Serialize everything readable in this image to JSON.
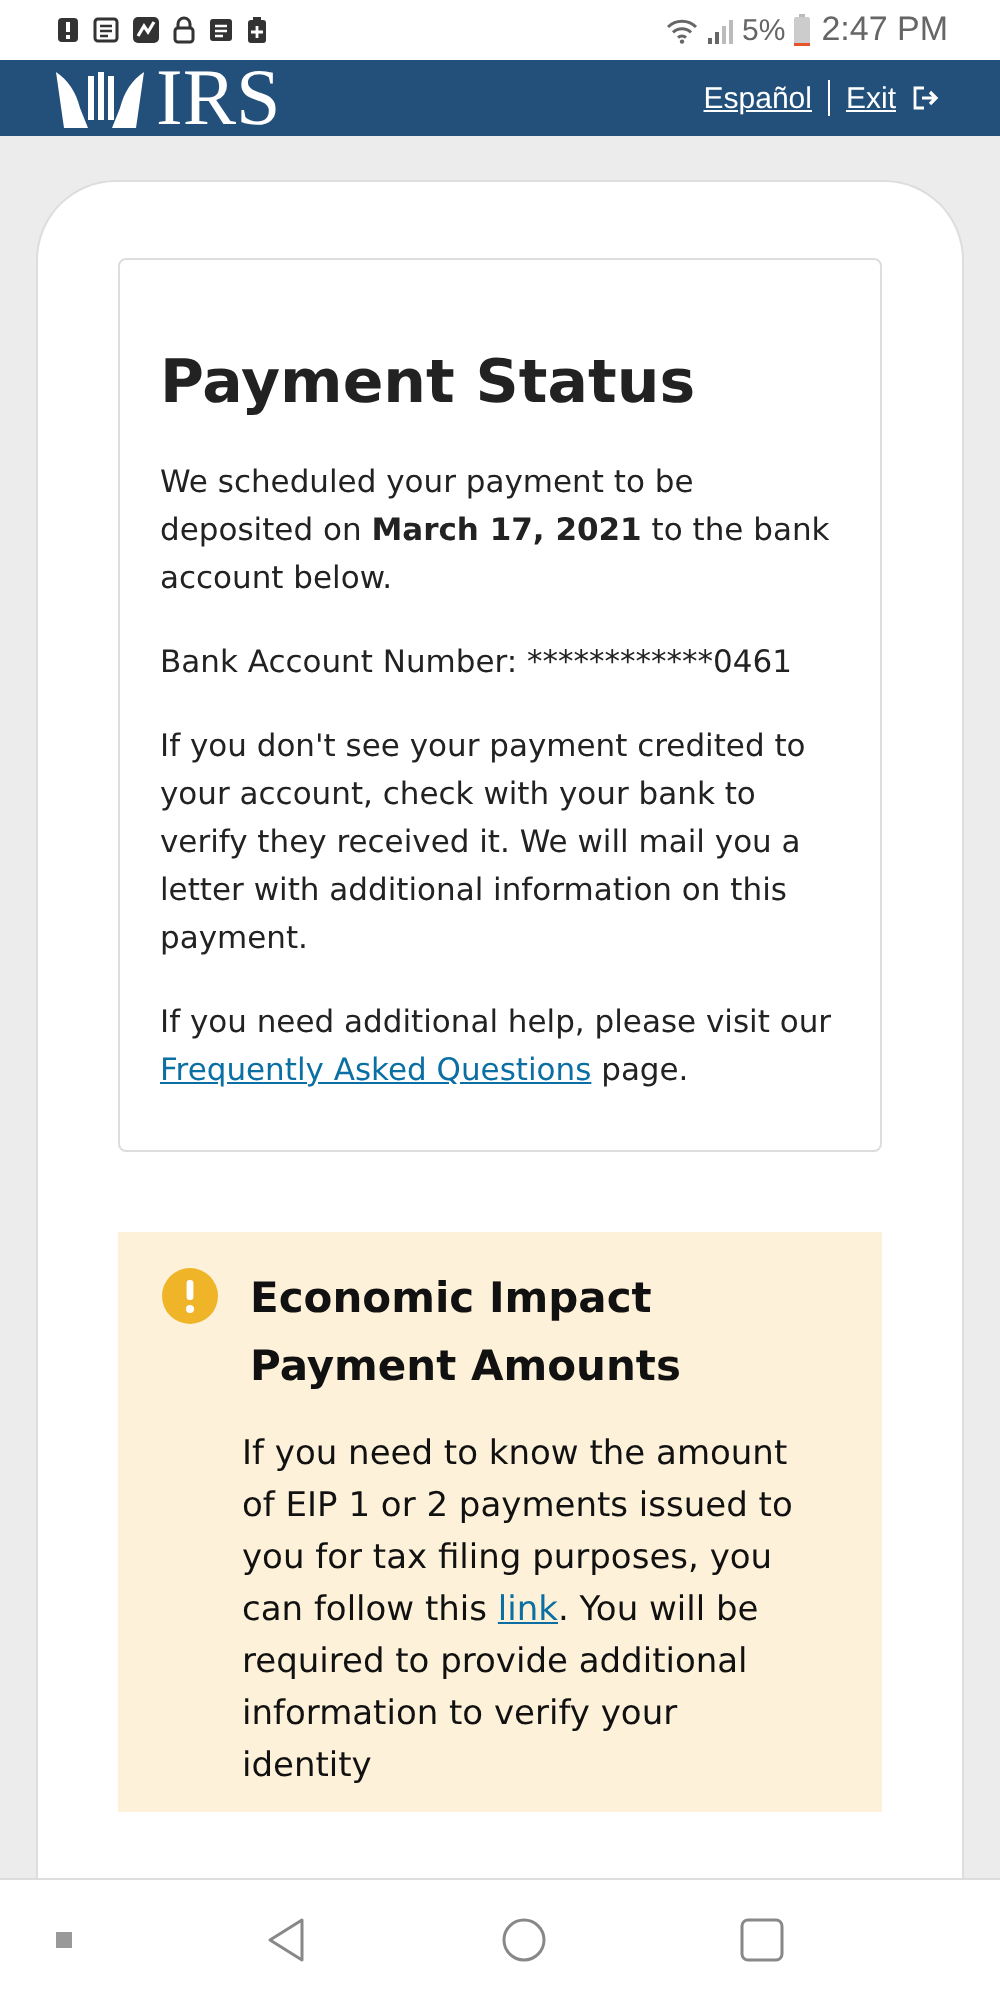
{
  "status_bar": {
    "battery": "5%",
    "time": "2:47 PM"
  },
  "header": {
    "logo": "IRS",
    "links": [
      {
        "label": "Español"
      },
      {
        "label": "Exit"
      }
    ]
  },
  "status_card": {
    "title": "Payment Status",
    "paragraphs": [
      "We scheduled your payment to be deposited on **March 17, 2021** to the bank account below."
    ],
    "account": "Bank Account Number: ************0461",
    "details": [
      "If you don't see your payment credited to your account, check with your bank to verify they received it. We will mail you a letter with additional information on this payment."
    ],
    "help": {
      "before": "If you need additional help, please visit our",
      "link": "Frequently Asked Questions",
      "after": "page."
    }
  },
  "alert": {
    "title": "Economic Impact Payment Amounts",
    "before": "If you need to know the amount of EIP 1 or 2 payments issued to you for tax filing purposes, you can follow this",
    "link": "link",
    "after": ". You will be required to provide additional information to verify your identity"
  }
}
